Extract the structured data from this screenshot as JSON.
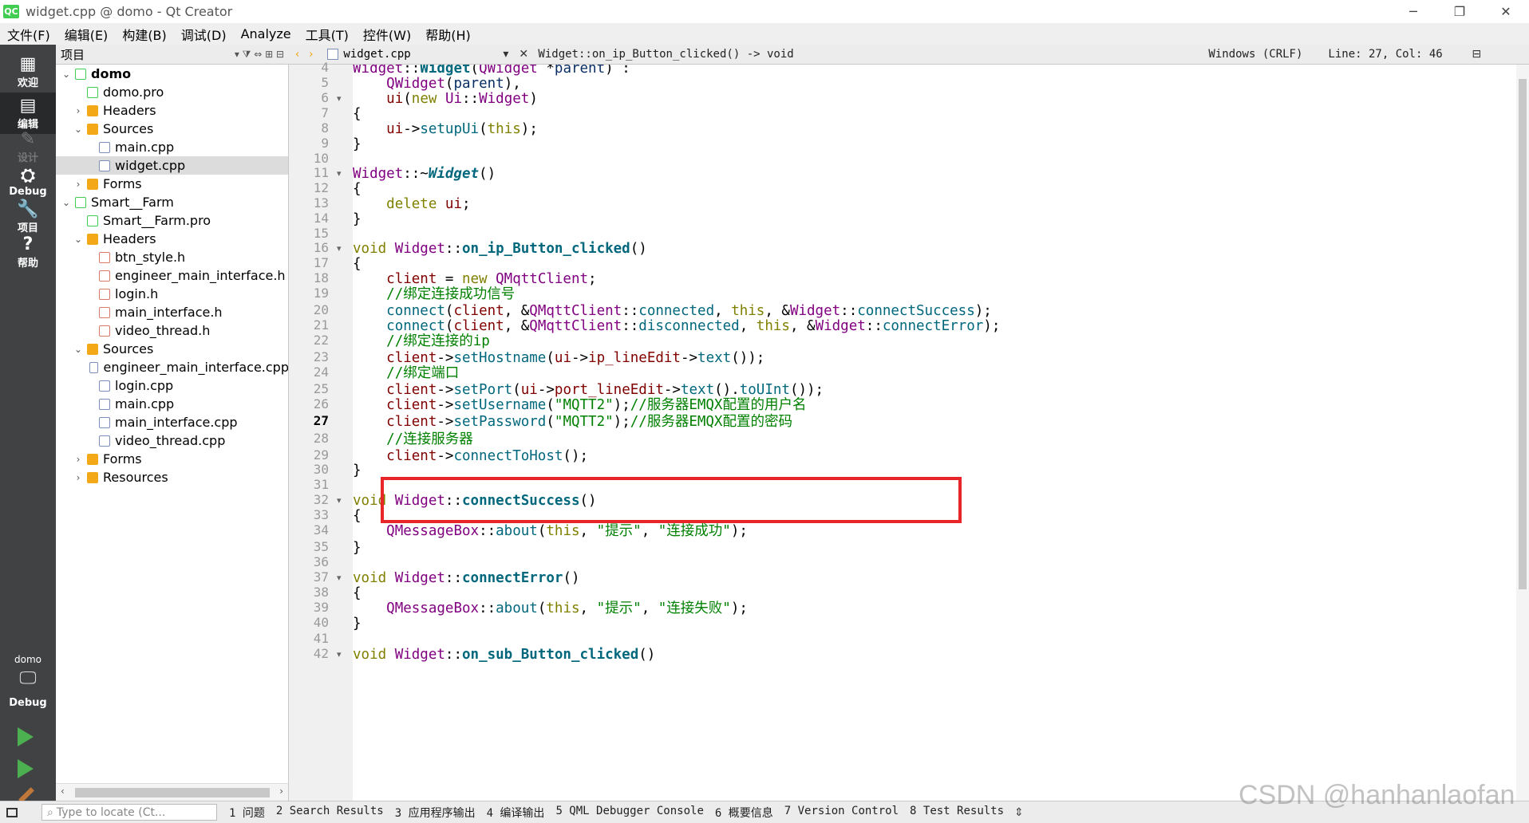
{
  "window": {
    "app_icon": "QC",
    "title": "widget.cpp @ domo - Qt Creator",
    "minimize": "─",
    "restore": "❐",
    "close": "✕"
  },
  "menu": [
    "文件(F)",
    "编辑(E)",
    "构建(B)",
    "调试(D)",
    "Analyze",
    "工具(T)",
    "控件(W)",
    "帮助(H)"
  ],
  "modes": [
    {
      "label": "欢迎",
      "icon": "▦"
    },
    {
      "label": "编辑",
      "icon": "▤"
    },
    {
      "label": "设计",
      "icon": "✎"
    },
    {
      "label": "Debug",
      "icon": "⛭"
    },
    {
      "label": "项目",
      "icon": "🔧"
    },
    {
      "label": "帮助",
      "icon": "?"
    }
  ],
  "kit": {
    "project": "domo",
    "config": "Debug"
  },
  "project_panel": {
    "title": "项目",
    "tree": [
      {
        "label": "domo",
        "icon": "pro",
        "bold": true,
        "arrow": "⌄"
      },
      {
        "label": "domo.pro",
        "icon": "pro",
        "arrow": ""
      },
      {
        "label": "Headers",
        "icon": "folder",
        "arrow": "›"
      },
      {
        "label": "Sources",
        "icon": "folder",
        "arrow": "⌄"
      },
      {
        "label": "main.cpp",
        "icon": "cpp",
        "arrow": ""
      },
      {
        "label": "widget.cpp",
        "icon": "cpp",
        "arrow": ""
      },
      {
        "label": "Forms",
        "icon": "folder",
        "arrow": "›"
      },
      {
        "label": "Smart__Farm",
        "icon": "pro",
        "arrow": "⌄"
      },
      {
        "label": "Smart__Farm.pro",
        "icon": "pro",
        "arrow": ""
      },
      {
        "label": "Headers",
        "icon": "folder",
        "arrow": "⌄"
      },
      {
        "label": "btn_style.h",
        "icon": "h",
        "arrow": ""
      },
      {
        "label": "engineer_main_interface.h",
        "icon": "h",
        "arrow": ""
      },
      {
        "label": "login.h",
        "icon": "h",
        "arrow": ""
      },
      {
        "label": "main_interface.h",
        "icon": "h",
        "arrow": ""
      },
      {
        "label": "video_thread.h",
        "icon": "h",
        "arrow": ""
      },
      {
        "label": "Sources",
        "icon": "folder",
        "arrow": "⌄"
      },
      {
        "label": "engineer_main_interface.cpp",
        "icon": "cpp",
        "arrow": ""
      },
      {
        "label": "login.cpp",
        "icon": "cpp",
        "arrow": ""
      },
      {
        "label": "main.cpp",
        "icon": "cpp",
        "arrow": ""
      },
      {
        "label": "main_interface.cpp",
        "icon": "cpp",
        "arrow": ""
      },
      {
        "label": "video_thread.cpp",
        "icon": "cpp",
        "arrow": ""
      },
      {
        "label": "Forms",
        "icon": "folder",
        "arrow": "›"
      },
      {
        "label": "Resources",
        "icon": "folder",
        "arrow": "›"
      }
    ]
  },
  "editor": {
    "file": "widget.cpp",
    "symbol": "Widget::on_ip_Button_clicked() -> void",
    "encoding": "Windows (CRLF)",
    "position": "Line: 27, Col: 46",
    "current_line": "27",
    "lines": [
      {
        "n": "4",
        "fold": ""
      },
      {
        "n": "5",
        "fold": ""
      },
      {
        "n": "6",
        "fold": "▾"
      },
      {
        "n": "7",
        "fold": ""
      },
      {
        "n": "8",
        "fold": ""
      },
      {
        "n": "9",
        "fold": ""
      },
      {
        "n": "10",
        "fold": ""
      },
      {
        "n": "11",
        "fold": "▾"
      },
      {
        "n": "12",
        "fold": ""
      },
      {
        "n": "13",
        "fold": ""
      },
      {
        "n": "14",
        "fold": ""
      },
      {
        "n": "15",
        "fold": ""
      },
      {
        "n": "16",
        "fold": "▾"
      },
      {
        "n": "17",
        "fold": ""
      },
      {
        "n": "18",
        "fold": ""
      },
      {
        "n": "19",
        "fold": ""
      },
      {
        "n": "20",
        "fold": ""
      },
      {
        "n": "21",
        "fold": ""
      },
      {
        "n": "22",
        "fold": ""
      },
      {
        "n": "23",
        "fold": ""
      },
      {
        "n": "24",
        "fold": ""
      },
      {
        "n": "25",
        "fold": ""
      },
      {
        "n": "26",
        "fold": ""
      },
      {
        "n": "27",
        "fold": ""
      },
      {
        "n": "28",
        "fold": ""
      },
      {
        "n": "29",
        "fold": ""
      },
      {
        "n": "30",
        "fold": ""
      },
      {
        "n": "31",
        "fold": ""
      },
      {
        "n": "32",
        "fold": "▾"
      },
      {
        "n": "33",
        "fold": ""
      },
      {
        "n": "34",
        "fold": ""
      },
      {
        "n": "35",
        "fold": ""
      },
      {
        "n": "36",
        "fold": ""
      },
      {
        "n": "37",
        "fold": "▾"
      },
      {
        "n": "38",
        "fold": ""
      },
      {
        "n": "39",
        "fold": ""
      },
      {
        "n": "40",
        "fold": ""
      },
      {
        "n": "41",
        "fold": ""
      },
      {
        "n": "42",
        "fold": "▾"
      }
    ],
    "code": [
      [
        [
          "cls",
          "Widget"
        ],
        [
          "",
          "::"
        ],
        [
          "fnb",
          "Widget"
        ],
        [
          "",
          "("
        ],
        [
          "cls",
          "QWidget"
        ],
        [
          "",
          " *"
        ],
        [
          "vr",
          "parent"
        ],
        [
          "",
          ") :"
        ]
      ],
      [
        [
          "",
          "    "
        ],
        [
          "cls",
          "QWidget"
        ],
        [
          "",
          "("
        ],
        [
          "vr",
          "parent"
        ],
        [
          "",
          "),"
        ]
      ],
      [
        [
          "",
          "    "
        ],
        [
          "mem",
          "ui"
        ],
        [
          "",
          "("
        ],
        [
          "kw",
          "new"
        ],
        [
          "",
          " "
        ],
        [
          "cls",
          "Ui"
        ],
        [
          "",
          "::"
        ],
        [
          "cls",
          "Widget"
        ],
        [
          "",
          ")"
        ]
      ],
      [
        [
          "",
          "{"
        ]
      ],
      [
        [
          "",
          "    "
        ],
        [
          "mem",
          "ui"
        ],
        [
          "",
          "->"
        ],
        [
          "fn",
          "setupUi"
        ],
        [
          "",
          "("
        ],
        [
          "kw",
          "this"
        ],
        [
          "",
          ");"
        ]
      ],
      [
        [
          "",
          "}"
        ]
      ],
      [
        [
          "",
          ""
        ]
      ],
      [
        [
          "cls",
          "Widget"
        ],
        [
          "",
          "::~"
        ],
        [
          "fi",
          "Widget"
        ],
        [
          "",
          "()"
        ]
      ],
      [
        [
          "",
          "{"
        ]
      ],
      [
        [
          "",
          "    "
        ],
        [
          "kw",
          "delete"
        ],
        [
          "",
          " "
        ],
        [
          "mem",
          "ui"
        ],
        [
          "",
          ";"
        ]
      ],
      [
        [
          "",
          "}"
        ]
      ],
      [
        [
          "",
          ""
        ]
      ],
      [
        [
          "kw",
          "void"
        ],
        [
          "",
          " "
        ],
        [
          "cls",
          "Widget"
        ],
        [
          "",
          "::"
        ],
        [
          "fnb",
          "on_ip_Button_clicked"
        ],
        [
          "",
          "()"
        ]
      ],
      [
        [
          "",
          "{"
        ]
      ],
      [
        [
          "",
          "    "
        ],
        [
          "mem",
          "client"
        ],
        [
          "",
          " = "
        ],
        [
          "kw",
          "new"
        ],
        [
          "",
          " "
        ],
        [
          "cls",
          "QMqttClient"
        ],
        [
          "",
          ";"
        ]
      ],
      [
        [
          "",
          "    "
        ],
        [
          "cm",
          "//绑定连接成功信号"
        ]
      ],
      [
        [
          "",
          "    "
        ],
        [
          "fn",
          "connect"
        ],
        [
          "",
          "("
        ],
        [
          "mem",
          "client"
        ],
        [
          "",
          ", &"
        ],
        [
          "cls",
          "QMqttClient"
        ],
        [
          "",
          "::"
        ],
        [
          "fn",
          "connected"
        ],
        [
          "",
          ", "
        ],
        [
          "kw",
          "this"
        ],
        [
          "",
          ", &"
        ],
        [
          "cls",
          "Widget"
        ],
        [
          "",
          "::"
        ],
        [
          "fn",
          "connectSuccess"
        ],
        [
          "",
          ");"
        ]
      ],
      [
        [
          "",
          "    "
        ],
        [
          "fn",
          "connect"
        ],
        [
          "",
          "("
        ],
        [
          "mem",
          "client"
        ],
        [
          "",
          ", &"
        ],
        [
          "cls",
          "QMqttClient"
        ],
        [
          "",
          "::"
        ],
        [
          "fn",
          "disconnected"
        ],
        [
          "",
          ", "
        ],
        [
          "kw",
          "this"
        ],
        [
          "",
          ", &"
        ],
        [
          "cls",
          "Widget"
        ],
        [
          "",
          "::"
        ],
        [
          "fn",
          "connectError"
        ],
        [
          "",
          ");"
        ]
      ],
      [
        [
          "",
          "    "
        ],
        [
          "cm",
          "//绑定连接的ip"
        ]
      ],
      [
        [
          "",
          "    "
        ],
        [
          "mem",
          "client"
        ],
        [
          "",
          "->"
        ],
        [
          "fn",
          "setHostname"
        ],
        [
          "",
          "("
        ],
        [
          "mem",
          "ui"
        ],
        [
          "",
          "->"
        ],
        [
          "mem",
          "ip_lineEdit"
        ],
        [
          "",
          "->"
        ],
        [
          "fn",
          "text"
        ],
        [
          "",
          "());"
        ]
      ],
      [
        [
          "",
          "    "
        ],
        [
          "cm",
          "//绑定端口"
        ]
      ],
      [
        [
          "",
          "    "
        ],
        [
          "mem",
          "client"
        ],
        [
          "",
          "->"
        ],
        [
          "fn",
          "setPort"
        ],
        [
          "",
          "("
        ],
        [
          "mem",
          "ui"
        ],
        [
          "",
          "->"
        ],
        [
          "mem",
          "port_lineEdit"
        ],
        [
          "",
          "->"
        ],
        [
          "fn",
          "text"
        ],
        [
          "",
          "()."
        ],
        [
          "fn",
          "toUInt"
        ],
        [
          "",
          "());"
        ]
      ],
      [
        [
          "",
          "    "
        ],
        [
          "mem",
          "client"
        ],
        [
          "",
          "->"
        ],
        [
          "fn",
          "setUsername"
        ],
        [
          "",
          "("
        ],
        [
          "str",
          "\"MQTT2\""
        ],
        [
          "",
          ");"
        ],
        [
          "cm",
          "//服务器EMQX配置的用户名"
        ]
      ],
      [
        [
          "",
          "    "
        ],
        [
          "mem",
          "client"
        ],
        [
          "",
          "->"
        ],
        [
          "fn",
          "setPassword"
        ],
        [
          "",
          "("
        ],
        [
          "str",
          "\"MQTT2\""
        ],
        [
          "",
          ");"
        ],
        [
          "cm",
          "//服务器EMQX配置的密码"
        ]
      ],
      [
        [
          "",
          "    "
        ],
        [
          "cm",
          "//连接服务器"
        ]
      ],
      [
        [
          "",
          "    "
        ],
        [
          "mem",
          "client"
        ],
        [
          "",
          "->"
        ],
        [
          "fn",
          "connectToHost"
        ],
        [
          "",
          "();"
        ]
      ],
      [
        [
          "",
          "}"
        ]
      ],
      [
        [
          "",
          ""
        ]
      ],
      [
        [
          "kw",
          "void"
        ],
        [
          "",
          " "
        ],
        [
          "cls",
          "Widget"
        ],
        [
          "",
          "::"
        ],
        [
          "fnb",
          "connectSuccess"
        ],
        [
          "",
          "()"
        ]
      ],
      [
        [
          "",
          "{"
        ]
      ],
      [
        [
          "",
          "    "
        ],
        [
          "cls",
          "QMessageBox"
        ],
        [
          "",
          "::"
        ],
        [
          "fn",
          "about"
        ],
        [
          "",
          "("
        ],
        [
          "kw",
          "this"
        ],
        [
          "",
          ", "
        ],
        [
          "str",
          "\"提示\""
        ],
        [
          "",
          ", "
        ],
        [
          "str",
          "\"连接成功\""
        ],
        [
          "",
          ");"
        ]
      ],
      [
        [
          "",
          "}"
        ]
      ],
      [
        [
          "",
          ""
        ]
      ],
      [
        [
          "kw",
          "void"
        ],
        [
          "",
          " "
        ],
        [
          "cls",
          "Widget"
        ],
        [
          "",
          "::"
        ],
        [
          "fnb",
          "connectError"
        ],
        [
          "",
          "()"
        ]
      ],
      [
        [
          "",
          "{"
        ]
      ],
      [
        [
          "",
          "    "
        ],
        [
          "cls",
          "QMessageBox"
        ],
        [
          "",
          "::"
        ],
        [
          "fn",
          "about"
        ],
        [
          "",
          "("
        ],
        [
          "kw",
          "this"
        ],
        [
          "",
          ", "
        ],
        [
          "str",
          "\"提示\""
        ],
        [
          "",
          ", "
        ],
        [
          "str",
          "\"连接失败\""
        ],
        [
          "",
          ");"
        ]
      ],
      [
        [
          "",
          "}"
        ]
      ],
      [
        [
          "",
          ""
        ]
      ],
      [
        [
          "kw",
          "void"
        ],
        [
          "",
          " "
        ],
        [
          "cls",
          "Widget"
        ],
        [
          "",
          "::"
        ],
        [
          "fnb",
          "on_sub_Button_clicked"
        ],
        [
          "",
          "()"
        ]
      ]
    ]
  },
  "output_panes": [
    "1 问题",
    "2 Search Results",
    "3 应用程序输出",
    "4 编译输出",
    "5 QML Debugger Console",
    "6 概要信息",
    "7 Version Control",
    "8 Test Results"
  ],
  "locator_placeholder": "Type to locate (Ct...",
  "watermark": "CSDN @hanhanlaofan"
}
